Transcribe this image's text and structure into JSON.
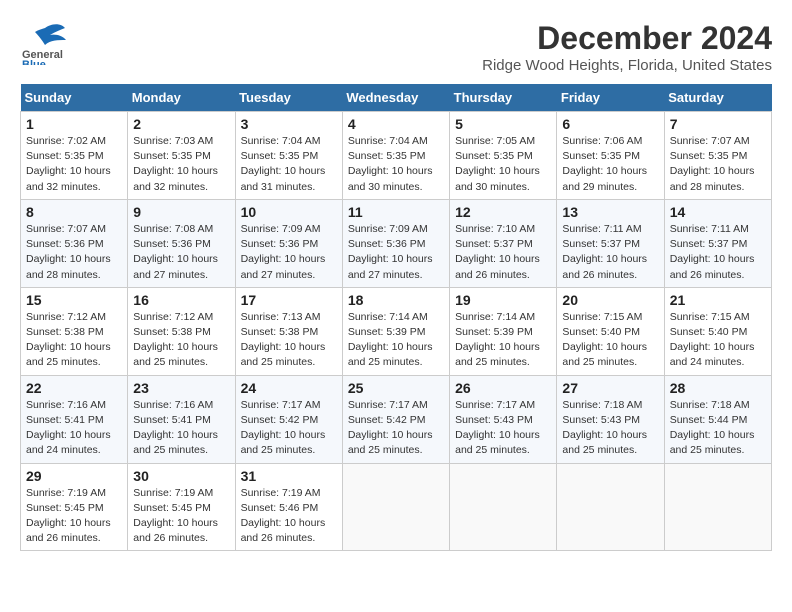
{
  "header": {
    "logo_general": "General",
    "logo_blue": "Blue",
    "month_year": "December 2024",
    "location": "Ridge Wood Heights, Florida, United States"
  },
  "weekdays": [
    "Sunday",
    "Monday",
    "Tuesday",
    "Wednesday",
    "Thursday",
    "Friday",
    "Saturday"
  ],
  "weeks": [
    [
      {
        "day": "1",
        "info": "Sunrise: 7:02 AM\nSunset: 5:35 PM\nDaylight: 10 hours\nand 32 minutes."
      },
      {
        "day": "2",
        "info": "Sunrise: 7:03 AM\nSunset: 5:35 PM\nDaylight: 10 hours\nand 32 minutes."
      },
      {
        "day": "3",
        "info": "Sunrise: 7:04 AM\nSunset: 5:35 PM\nDaylight: 10 hours\nand 31 minutes."
      },
      {
        "day": "4",
        "info": "Sunrise: 7:04 AM\nSunset: 5:35 PM\nDaylight: 10 hours\nand 30 minutes."
      },
      {
        "day": "5",
        "info": "Sunrise: 7:05 AM\nSunset: 5:35 PM\nDaylight: 10 hours\nand 30 minutes."
      },
      {
        "day": "6",
        "info": "Sunrise: 7:06 AM\nSunset: 5:35 PM\nDaylight: 10 hours\nand 29 minutes."
      },
      {
        "day": "7",
        "info": "Sunrise: 7:07 AM\nSunset: 5:35 PM\nDaylight: 10 hours\nand 28 minutes."
      }
    ],
    [
      {
        "day": "8",
        "info": "Sunrise: 7:07 AM\nSunset: 5:36 PM\nDaylight: 10 hours\nand 28 minutes."
      },
      {
        "day": "9",
        "info": "Sunrise: 7:08 AM\nSunset: 5:36 PM\nDaylight: 10 hours\nand 27 minutes."
      },
      {
        "day": "10",
        "info": "Sunrise: 7:09 AM\nSunset: 5:36 PM\nDaylight: 10 hours\nand 27 minutes."
      },
      {
        "day": "11",
        "info": "Sunrise: 7:09 AM\nSunset: 5:36 PM\nDaylight: 10 hours\nand 27 minutes."
      },
      {
        "day": "12",
        "info": "Sunrise: 7:10 AM\nSunset: 5:37 PM\nDaylight: 10 hours\nand 26 minutes."
      },
      {
        "day": "13",
        "info": "Sunrise: 7:11 AM\nSunset: 5:37 PM\nDaylight: 10 hours\nand 26 minutes."
      },
      {
        "day": "14",
        "info": "Sunrise: 7:11 AM\nSunset: 5:37 PM\nDaylight: 10 hours\nand 26 minutes."
      }
    ],
    [
      {
        "day": "15",
        "info": "Sunrise: 7:12 AM\nSunset: 5:38 PM\nDaylight: 10 hours\nand 25 minutes."
      },
      {
        "day": "16",
        "info": "Sunrise: 7:12 AM\nSunset: 5:38 PM\nDaylight: 10 hours\nand 25 minutes."
      },
      {
        "day": "17",
        "info": "Sunrise: 7:13 AM\nSunset: 5:38 PM\nDaylight: 10 hours\nand 25 minutes."
      },
      {
        "day": "18",
        "info": "Sunrise: 7:14 AM\nSunset: 5:39 PM\nDaylight: 10 hours\nand 25 minutes."
      },
      {
        "day": "19",
        "info": "Sunrise: 7:14 AM\nSunset: 5:39 PM\nDaylight: 10 hours\nand 25 minutes."
      },
      {
        "day": "20",
        "info": "Sunrise: 7:15 AM\nSunset: 5:40 PM\nDaylight: 10 hours\nand 25 minutes."
      },
      {
        "day": "21",
        "info": "Sunrise: 7:15 AM\nSunset: 5:40 PM\nDaylight: 10 hours\nand 24 minutes."
      }
    ],
    [
      {
        "day": "22",
        "info": "Sunrise: 7:16 AM\nSunset: 5:41 PM\nDaylight: 10 hours\nand 24 minutes."
      },
      {
        "day": "23",
        "info": "Sunrise: 7:16 AM\nSunset: 5:41 PM\nDaylight: 10 hours\nand 25 minutes."
      },
      {
        "day": "24",
        "info": "Sunrise: 7:17 AM\nSunset: 5:42 PM\nDaylight: 10 hours\nand 25 minutes."
      },
      {
        "day": "25",
        "info": "Sunrise: 7:17 AM\nSunset: 5:42 PM\nDaylight: 10 hours\nand 25 minutes."
      },
      {
        "day": "26",
        "info": "Sunrise: 7:17 AM\nSunset: 5:43 PM\nDaylight: 10 hours\nand 25 minutes."
      },
      {
        "day": "27",
        "info": "Sunrise: 7:18 AM\nSunset: 5:43 PM\nDaylight: 10 hours\nand 25 minutes."
      },
      {
        "day": "28",
        "info": "Sunrise: 7:18 AM\nSunset: 5:44 PM\nDaylight: 10 hours\nand 25 minutes."
      }
    ],
    [
      {
        "day": "29",
        "info": "Sunrise: 7:19 AM\nSunset: 5:45 PM\nDaylight: 10 hours\nand 26 minutes."
      },
      {
        "day": "30",
        "info": "Sunrise: 7:19 AM\nSunset: 5:45 PM\nDaylight: 10 hours\nand 26 minutes."
      },
      {
        "day": "31",
        "info": "Sunrise: 7:19 AM\nSunset: 5:46 PM\nDaylight: 10 hours\nand 26 minutes."
      },
      {
        "day": "",
        "info": ""
      },
      {
        "day": "",
        "info": ""
      },
      {
        "day": "",
        "info": ""
      },
      {
        "day": "",
        "info": ""
      }
    ]
  ]
}
